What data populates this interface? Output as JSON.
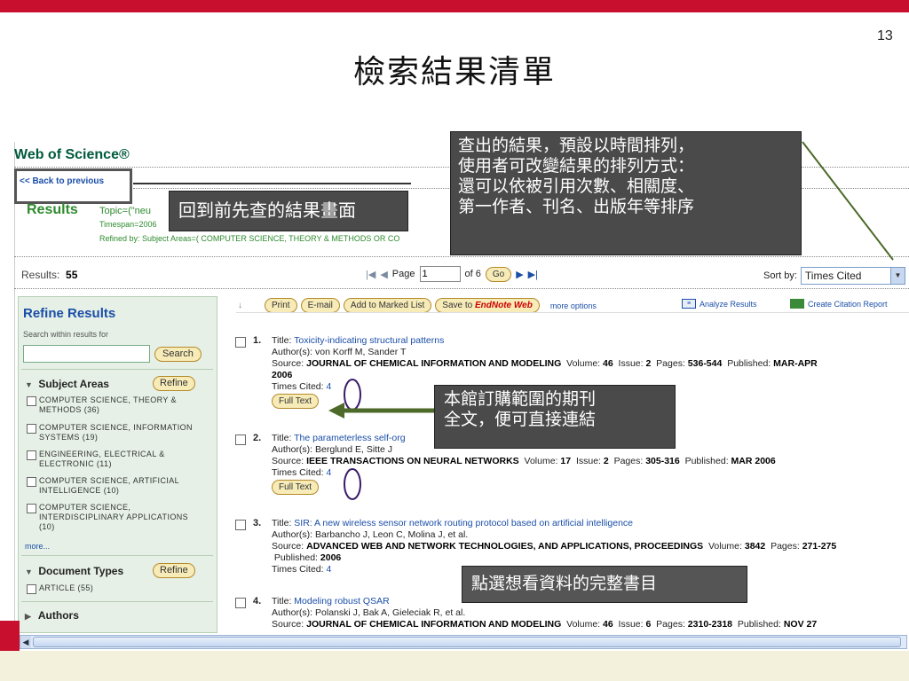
{
  "slide": {
    "page_number": "13",
    "title": "檢索結果清單"
  },
  "app": {
    "title": "Web of Science®",
    "back_link": "<< Back to previous"
  },
  "results_header": {
    "heading": "Results",
    "topic": "Topic=(\"neu",
    "timespan": "Timespan=2006",
    "refined": "Refined by: Subject Areas=( COMPUTER SCIENCE, THEORY & METHODS OR CO"
  },
  "results_bar": {
    "label": "Results:",
    "count": "55",
    "page_label": "Page",
    "page_value": "1",
    "of_label": "of 6",
    "go": "Go",
    "sort_label": "Sort by:",
    "sort_value": "Times Cited"
  },
  "sidebar": {
    "title": "Refine Results",
    "search_within": "Search within results for",
    "search_button": "Search",
    "subject_areas": {
      "label": "Subject Areas",
      "refine": "Refine",
      "items": [
        "COMPUTER SCIENCE, THEORY & METHODS (36)",
        "COMPUTER SCIENCE, INFORMATION SYSTEMS (19)",
        "ENGINEERING, ELECTRICAL & ELECTRONIC (11)",
        "COMPUTER SCIENCE, ARTIFICIAL INTELLIGENCE (10)",
        "COMPUTER SCIENCE, INTERDISCIPLINARY APPLICATIONS (10)"
      ],
      "more": "more..."
    },
    "document_types": {
      "label": "Document Types",
      "refine": "Refine",
      "items": [
        "ARTICLE (55)"
      ]
    },
    "authors": {
      "label": "Authors"
    }
  },
  "toolbar": {
    "print": "Print",
    "email": "E-mail",
    "add_marked": "Add to Marked List",
    "save_to": "Save to",
    "endnote": "EndNote Web",
    "more_options": "more options",
    "analyze": "Analyze Results",
    "citation_report": "Create Citation Report"
  },
  "records": [
    {
      "num": "1.",
      "title_label": "Title:",
      "title": "Toxicity-indicating structural patterns",
      "authors_label": "Author(s):",
      "authors": "von Korff M, Sander T",
      "source_label": "Source:",
      "source": "JOURNAL OF CHEMICAL INFORMATION AND MODELING",
      "details_1": "Volume:",
      "volume": "46",
      "details_2": "Issue:",
      "issue": "2",
      "details_3": "Pages:",
      "pages": "536-544",
      "details_4": "Published:",
      "published": "MAR-APR",
      "year_line": "2006",
      "cited_label": "Times Cited:",
      "cited": "4",
      "full_text": "Full Text"
    },
    {
      "num": "2.",
      "title_label": "Title:",
      "title": "The parameterless self-org",
      "authors_label": "Author(s):",
      "authors": "Berglund E, Sitte J",
      "source_label": "Source:",
      "source": "IEEE TRANSACTIONS ON NEURAL NETWORKS",
      "details_1": "Volume:",
      "volume": "17",
      "details_2": "Issue:",
      "issue": "2",
      "details_3": "Pages:",
      "pages": "305-316",
      "details_4": "Published:",
      "published": "MAR 2006",
      "cited_label": "Times Cited:",
      "cited": "4",
      "full_text": "Full Text"
    },
    {
      "num": "3.",
      "title_label": "Title:",
      "title": "SIR: A new wireless sensor network routing protocol based on artificial intelligence",
      "authors_label": "Author(s):",
      "authors": "Barbancho J, Leon C, Molina J, et al.",
      "source_label": "Source:",
      "source": "ADVANCED WEB AND NETWORK TECHNOLOGIES, AND APPLICATIONS, PROCEEDINGS",
      "details_1": "Volume:",
      "volume": "3842",
      "details_3": "Pages:",
      "pages": "271-275",
      "details_4": "Published:",
      "published": "2006",
      "cited_label": "Times Cited:",
      "cited": "4"
    },
    {
      "num": "4.",
      "title_label": "Title:",
      "title": "Modeling robust QSAR",
      "authors_label": "Author(s):",
      "authors": "Polanski J, Bak A, Gieleciak R, et al.",
      "source_label": "Source:",
      "source": "JOURNAL OF CHEMICAL INFORMATION AND MODELING",
      "details_1": "Volume:",
      "volume": "46",
      "details_2": "Issue:",
      "issue": "6",
      "details_3": "Pages:",
      "pages": "2310-2318",
      "details_4": "Published:",
      "published": "NOV 27"
    }
  ],
  "callouts": {
    "sort": [
      "查出的結果，預設以時間排列，",
      "使用者可改變結果的排列方式：",
      "還可以依被引用次數、相關度、",
      "第一作者、刊名、出版年等排序"
    ],
    "back": "回到前先查的結果畫面",
    "fulltext": [
      "本館訂購範圍的期刊",
      "全文，便可直接連結"
    ],
    "record": "點選想看資料的完整書目"
  },
  "colors": {
    "accent_red": "#c8102e",
    "wos_green": "#005a3c",
    "link_blue": "#1a4ea8",
    "callout_bg": "#4a4a4a",
    "arrow_green": "#4d6a2a"
  }
}
